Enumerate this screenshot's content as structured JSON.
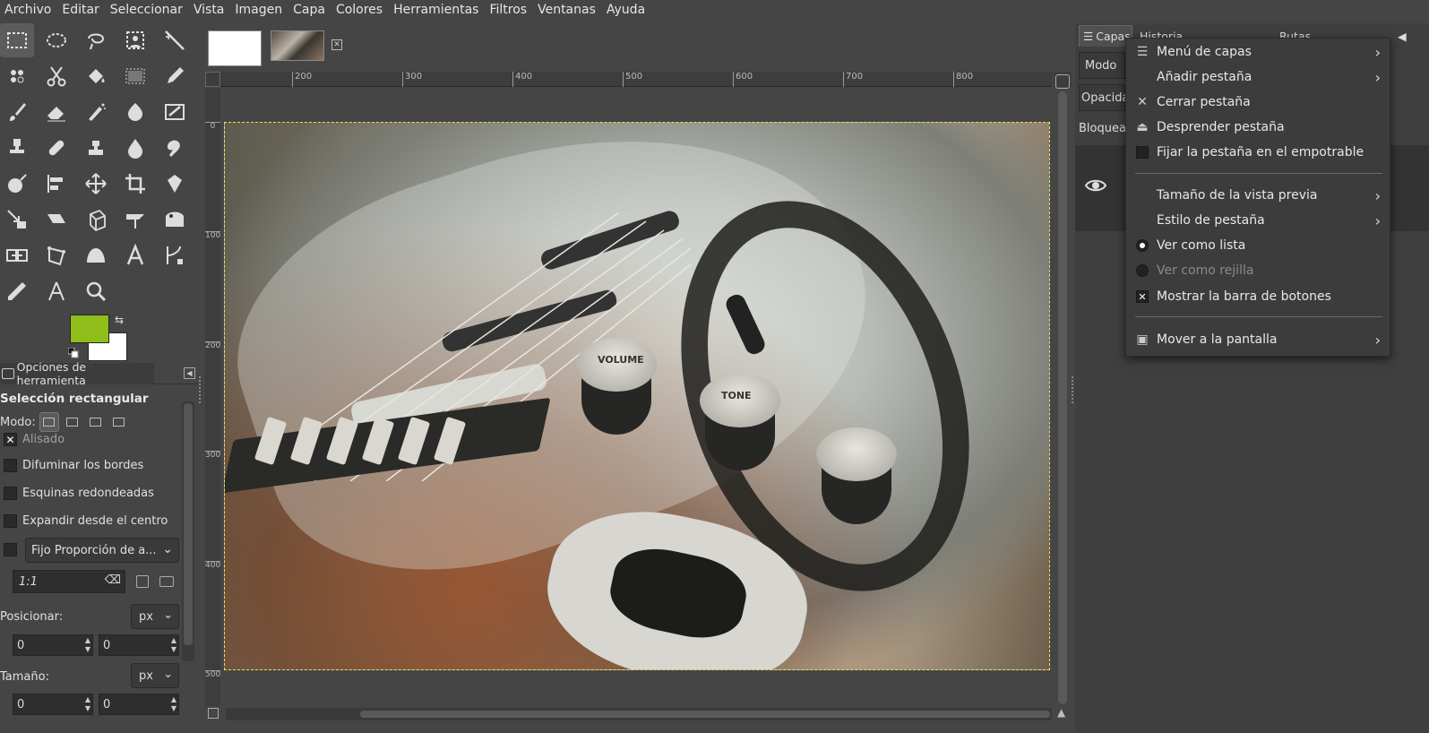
{
  "menubar": [
    "Archivo",
    "Editar",
    "Seleccionar",
    "Vista",
    "Imagen",
    "Capa",
    "Colores",
    "Herramientas",
    "Filtros",
    "Ventanas",
    "Ayuda"
  ],
  "colors": {
    "foreground": "#8fbd1a",
    "background": "#ffffff",
    "accent": "#e8e060"
  },
  "toolbox": {
    "tools": [
      "rect-select",
      "ellipse-select",
      "free-select",
      "foreground-select",
      "fuzzy-select",
      "by-color-select",
      "scissors-select",
      "bucket-fill",
      "gradient",
      "pencil",
      "paintbrush",
      "eraser",
      "airbrush",
      "ink",
      "mypaint-brush",
      "clone",
      "heal",
      "perspective-clone",
      "blur",
      "smudge",
      "dodge-burn",
      "align",
      "move",
      "crop",
      "unified-transform",
      "rotate",
      "shear",
      "3d-transform",
      "flip",
      "cage",
      "warp",
      "handle-transform",
      "warp-transform",
      "text",
      "paths",
      "color-picker",
      "measure",
      "zoom"
    ]
  },
  "tool_options": {
    "tab_label": "Opciones de herramienta",
    "title": "Selección rectangular",
    "mode_label": "Modo:",
    "antialias": "Alisado",
    "feather": "Difuminar los bordes",
    "rounded": "Esquinas redondeadas",
    "expand": "Expandir desde el centro",
    "fixed": "Fijo Proporción de a...",
    "ratio": "1:1",
    "position_label": "Posicionar:",
    "size_label": "Tamaño:",
    "unit": "px",
    "pos_x": "0",
    "pos_y": "0",
    "size_w": "0",
    "size_h": "0"
  },
  "ruler": {
    "top": [
      "200",
      "300",
      "400",
      "500",
      "600",
      "700",
      "800"
    ],
    "left": [
      "0",
      "100",
      "200",
      "300",
      "400",
      "500"
    ]
  },
  "image_labels": {
    "volume": "VOLUME",
    "tone": "TONE"
  },
  "dock": {
    "tabs": [
      "Capas",
      "Historia",
      "Rutas"
    ],
    "mode_label": "Modo",
    "opacity_label": "Opacida",
    "lock_label": "Bloquear"
  },
  "context_menu": {
    "items": [
      {
        "label": "Menú de capas",
        "submenu": true,
        "icon": "layers-icon"
      },
      {
        "label": "Añadir pestaña",
        "submenu": true,
        "icon": ""
      },
      {
        "label": "Cerrar pestaña",
        "submenu": false,
        "icon": "close-icon"
      },
      {
        "label": "Desprender pestaña",
        "submenu": false,
        "icon": "detach-icon"
      },
      {
        "label": "Fijar la pestaña en el empotrable",
        "submenu": false,
        "icon": "checkbox"
      },
      {
        "label": "Tamaño de la vista previa",
        "submenu": true,
        "icon": ""
      },
      {
        "label": "Estilo de pestaña",
        "submenu": true,
        "icon": ""
      },
      {
        "label": "Ver como lista",
        "submenu": false,
        "icon": "radio-on"
      },
      {
        "label": "Ver como rejilla",
        "submenu": false,
        "icon": "radio-off",
        "disabled": true
      },
      {
        "label": "Mostrar la barra de botones",
        "submenu": false,
        "icon": "checkbox-checked"
      },
      {
        "label": "Mover a la pantalla",
        "submenu": true,
        "icon": "screen-icon"
      }
    ]
  }
}
